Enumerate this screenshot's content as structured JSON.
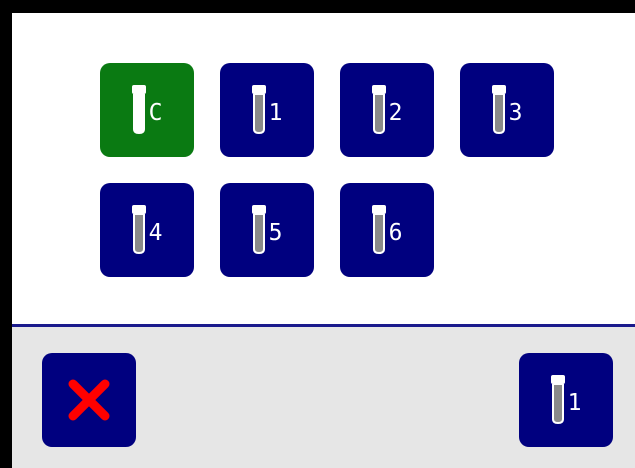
{
  "tubes": [
    {
      "label": "C",
      "state": "selected",
      "color": "#0a7a12"
    },
    {
      "label": "1",
      "state": "normal",
      "color": "#00007f"
    },
    {
      "label": "2",
      "state": "normal",
      "color": "#00007f"
    },
    {
      "label": "3",
      "state": "normal",
      "color": "#00007f"
    },
    {
      "label": "4",
      "state": "normal",
      "color": "#00007f"
    },
    {
      "label": "5",
      "state": "normal",
      "color": "#00007f"
    },
    {
      "label": "6",
      "state": "normal",
      "color": "#00007f"
    }
  ],
  "footer": {
    "cancel_icon": "close-icon",
    "cancel_color": "#ff0000",
    "current_tube_label": "1"
  },
  "icons": {
    "tube": "test-tube-icon"
  }
}
